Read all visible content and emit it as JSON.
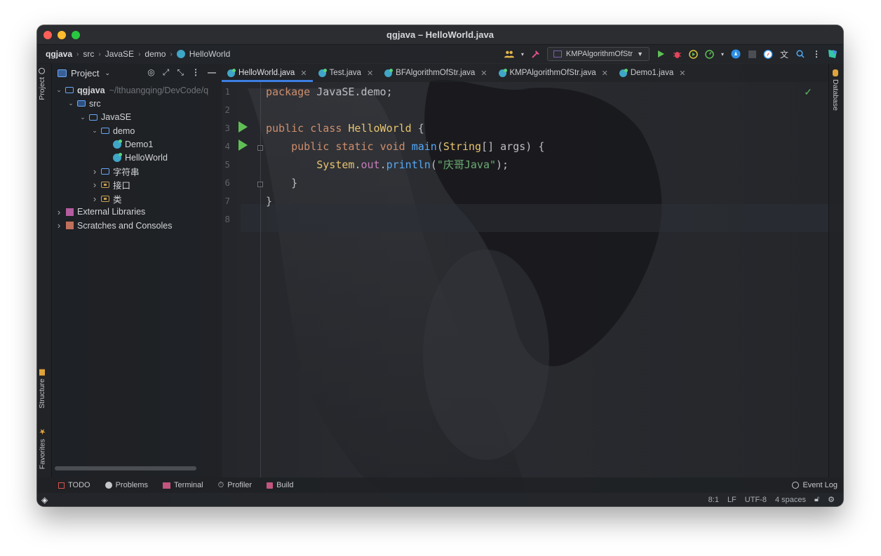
{
  "window": {
    "title": "qgjava – HelloWorld.java"
  },
  "breadcrumbs": [
    "qgjava",
    "src",
    "JavaSE",
    "demo",
    "HelloWorld"
  ],
  "toolbar": {
    "run_config": "KMPAlgorithmOfStr",
    "icons": [
      "users-icon",
      "hammer-icon",
      "run-icon",
      "debug-icon",
      "coverage-icon",
      "profile-icon",
      "dropdown-icon",
      "plugin-icon",
      "stop-icon",
      "safari-icon",
      "translate-icon",
      "search-icon",
      "more-icon",
      "jetbrains-icon"
    ]
  },
  "left_strip": {
    "project": "Project",
    "structure": "Structure",
    "favorites": "Favorites"
  },
  "right_strip": {
    "database": "Database"
  },
  "project_panel": {
    "title": "Project",
    "tree": [
      {
        "level": 0,
        "arrow": "open",
        "icon": "folder",
        "label": "qgjava",
        "path": "~/lthuangqing/DevCode/q",
        "bold": true
      },
      {
        "level": 1,
        "arrow": "open",
        "icon": "src",
        "label": "src"
      },
      {
        "level": 2,
        "arrow": "open",
        "icon": "folder",
        "label": "JavaSE"
      },
      {
        "level": 3,
        "arrow": "open",
        "icon": "folder",
        "label": "demo"
      },
      {
        "level": 4,
        "arrow": "none",
        "icon": "java",
        "label": "Demo1"
      },
      {
        "level": 4,
        "arrow": "none",
        "icon": "java",
        "label": "HelloWorld"
      },
      {
        "level": 3,
        "arrow": "closed",
        "icon": "folder",
        "label": "字符串"
      },
      {
        "level": 3,
        "arrow": "closed",
        "icon": "package",
        "label": "接口"
      },
      {
        "level": 3,
        "arrow": "closed",
        "icon": "package",
        "label": "类"
      },
      {
        "level": 0,
        "arrow": "closed",
        "icon": "library",
        "label": "External Libraries"
      },
      {
        "level": 0,
        "arrow": "closed",
        "icon": "scratch",
        "label": "Scratches and Consoles"
      }
    ]
  },
  "editor_tabs": [
    {
      "label": "HelloWorld.java",
      "active": true
    },
    {
      "label": "Test.java",
      "active": false
    },
    {
      "label": "BFAlgorithmOfStr.java",
      "active": false
    },
    {
      "label": "KMPAlgorithmOfStr.java",
      "active": false
    },
    {
      "label": "Demo1.java",
      "active": false
    }
  ],
  "code": {
    "line_numbers": [
      "1",
      "2",
      "3",
      "4",
      "5",
      "6",
      "7",
      "8"
    ],
    "l1_kw": "package",
    "l1_rest": " JavaSE.demo;",
    "l3_kw1": "public",
    "l3_kw2": "class",
    "l3_name": "HelloWorld",
    "l3_brace": " {",
    "l4_kw1": "public",
    "l4_kw2": "static",
    "l4_kw3": "void",
    "l4_name": "main",
    "l4_open": "(",
    "l4_type": "String",
    "l4_arr": "[] ",
    "l4_param": "args",
    "l4_close": ") {",
    "l5_cls": "System",
    "l5_dot1": ".",
    "l5_fld": "out",
    "l5_dot2": ".",
    "l5_mth": "println",
    "l5_open": "(",
    "l5_str": "\"庆哥Java\"",
    "l5_close": ");",
    "l6": "}",
    "l7": "}"
  },
  "bottom_tabs": [
    "TODO",
    "Problems",
    "Terminal",
    "Profiler",
    "Build"
  ],
  "event_log": "Event Log",
  "status": {
    "position": "8:1",
    "line_sep": "LF",
    "encoding": "UTF-8",
    "indent": "4 spaces"
  },
  "colors": {
    "accent": "#3d7ee3",
    "run": "#5fbf55",
    "keyword": "#cf8e6d",
    "string": "#6aab73"
  }
}
